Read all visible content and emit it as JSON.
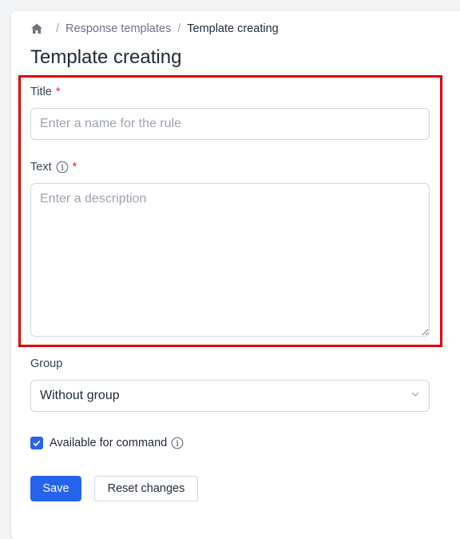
{
  "breadcrumb": {
    "home_icon": "home-icon",
    "items": [
      "Response templates",
      "Template creating"
    ],
    "separator": "/"
  },
  "page": {
    "title": "Template creating"
  },
  "form": {
    "title": {
      "label": "Title",
      "required_mark": "*",
      "placeholder": "Enter a name for the rule",
      "value": ""
    },
    "text": {
      "label": "Text",
      "required_mark": "*",
      "placeholder": "Enter a description",
      "value": "",
      "info_icon": "info-icon"
    },
    "group": {
      "label": "Group",
      "selected": "Without group"
    },
    "available": {
      "label": "Available for command",
      "checked": true,
      "info_icon": "info-icon"
    }
  },
  "actions": {
    "save_label": "Save",
    "reset_label": "Reset changes"
  },
  "colors": {
    "accent": "#2563eb",
    "required": "#dc2626",
    "highlight": "#e00000"
  }
}
